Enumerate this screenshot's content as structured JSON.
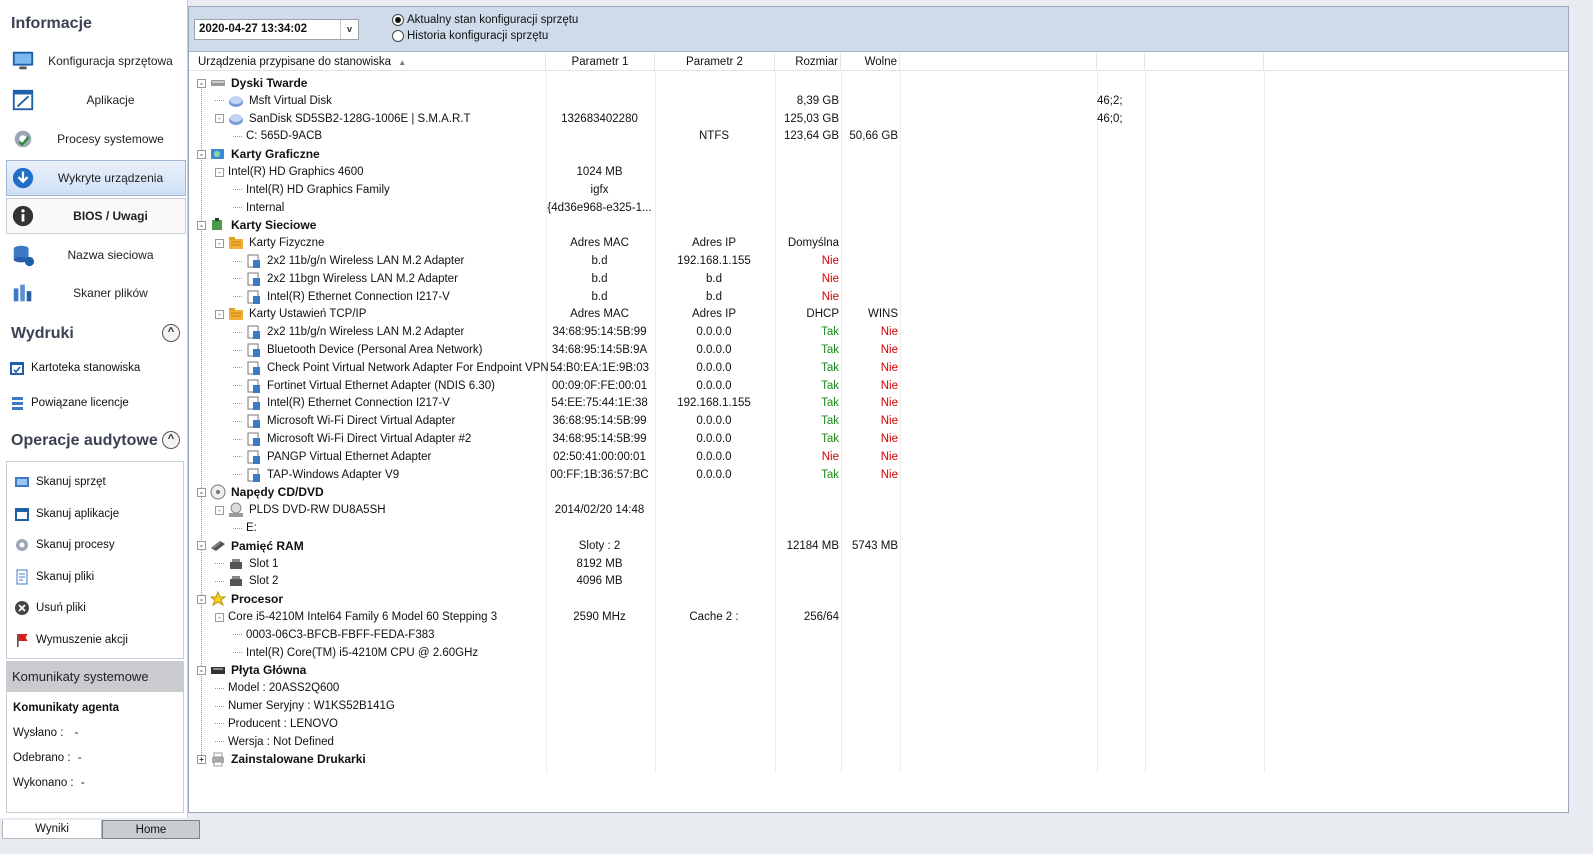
{
  "sidebar": {
    "info_header": "Informacje",
    "nav": [
      {
        "label": "Konfiguracja sprzętowa",
        "icon": "monitor-icon"
      },
      {
        "label": "Aplikacje",
        "icon": "app-window-icon"
      },
      {
        "label": "Procesy systemowe",
        "icon": "gear-process-icon"
      },
      {
        "label": "Wykryte urządzenia",
        "icon": "download-arrow-icon"
      },
      {
        "label": "BIOS / Uwagi",
        "icon": "info-circle-icon"
      },
      {
        "label": "Nazwa sieciowa",
        "icon": "database-network-icon"
      },
      {
        "label": "Skaner plików",
        "icon": "file-scanner-icon"
      }
    ],
    "prints_header": "Wydruki",
    "prints": [
      {
        "label": "Kartoteka stanowiska",
        "icon": "card-file-icon"
      },
      {
        "label": "Powiązane licencje",
        "icon": "license-stack-icon"
      }
    ],
    "ops_header": "Operacje audytowe",
    "ops": [
      {
        "label": "Skanuj sprzęt",
        "icon": "scan-hardware-icon"
      },
      {
        "label": "Skanuj aplikacje",
        "icon": "scan-apps-icon"
      },
      {
        "label": "Skanuj procesy",
        "icon": "scan-process-icon"
      },
      {
        "label": "Skanuj pliki",
        "icon": "scan-files-icon"
      },
      {
        "label": "Usuń pliki",
        "icon": "delete-circle-icon"
      },
      {
        "label": "Wymuszenie akcji",
        "icon": "red-flag-icon"
      }
    ],
    "collapse_glyph": "^",
    "messages": {
      "header": "Komunikaty systemowe",
      "agent_title": "Komunikaty agenta",
      "sent_label": "Wysłano :",
      "sent_value": "-",
      "received_label": "Odebrano :",
      "received_value": "-",
      "done_label": "Wykonano :",
      "done_value": "-"
    }
  },
  "toolbar": {
    "datetime": "2020-04-27   13:34:02",
    "dropdown_glyph": "v",
    "radio_current": "Aktualny stan konfiguracji sprzętu",
    "radio_history": "Historia konfiguracji sprzętu",
    "selected": "current"
  },
  "grid": {
    "columns": [
      "Urządzenia przypisane do stanowiska",
      "Parametr 1",
      "Parametr 2",
      "Rozmiar",
      "Wolne"
    ],
    "sort_glyph": "▲",
    "rows": [
      {
        "level": 0,
        "toggle": "-",
        "icon": "hdd-icon",
        "label": "Dyski Twarde",
        "bold": true
      },
      {
        "level": 1,
        "toggle": "",
        "icon": "disk-icon",
        "label": "Msft Virtual Disk",
        "c3": "8,39 GB",
        "c5": "46;2;"
      },
      {
        "level": 1,
        "toggle": "-",
        "icon": "disk-icon",
        "label": "SanDisk SD5SB2-128G-1006E   |  S.M.A.R.T",
        "c1": "132683402280",
        "c3": "125,03 GB",
        "c5": "46;0;"
      },
      {
        "level": 2,
        "toggle": "",
        "icon": "",
        "label": "C: 565D-9ACB",
        "c2": "NTFS",
        "c3": "123,64 GB",
        "c4": "50,66 GB"
      },
      {
        "level": 0,
        "toggle": "-",
        "icon": "gpu-icon",
        "label": "Karty Graficzne",
        "bold": true
      },
      {
        "level": 1,
        "toggle": "-",
        "icon": "",
        "label": "Intel(R) HD Graphics 4600",
        "c1": "1024 MB"
      },
      {
        "level": 2,
        "toggle": "",
        "icon": "",
        "label": "Intel(R) HD Graphics Family",
        "c1": "igfx"
      },
      {
        "level": 2,
        "toggle": "",
        "icon": "",
        "label": "Internal",
        "c1": "{4d36e968-e325-1..."
      },
      {
        "level": 0,
        "toggle": "-",
        "icon": "network-card-icon",
        "label": "Karty Sieciowe",
        "bold": true
      },
      {
        "level": 1,
        "toggle": "-",
        "icon": "folder-icon",
        "label": "Karty Fizyczne",
        "c1": "Adres MAC",
        "c2": "Adres IP",
        "c3": "Domyślna"
      },
      {
        "level": 2,
        "toggle": "",
        "icon": "adapter-icon",
        "label": "2x2 11b/g/n Wireless LAN M.2 Adapter",
        "c1": "b.d",
        "c2": "192.168.1.155",
        "c3": "Nie",
        "c3c": "red"
      },
      {
        "level": 2,
        "toggle": "",
        "icon": "adapter-icon",
        "label": "2x2 11bgn Wireless LAN M.2 Adapter",
        "c1": "b.d",
        "c2": "b.d",
        "c3": "Nie",
        "c3c": "red"
      },
      {
        "level": 2,
        "toggle": "",
        "icon": "adapter-icon",
        "label": "Intel(R) Ethernet Connection I217-V",
        "c1": "b.d",
        "c2": "b.d",
        "c3": "Nie",
        "c3c": "red"
      },
      {
        "level": 1,
        "toggle": "-",
        "icon": "folder-icon",
        "label": "Karty Ustawień TCP/IP",
        "c1": "Adres MAC",
        "c2": "Adres IP",
        "c3": "DHCP",
        "c4": "WINS"
      },
      {
        "level": 2,
        "toggle": "",
        "icon": "adapter-icon",
        "label": "2x2 11b/g/n Wireless LAN M.2 Adapter",
        "c1": "34:68:95:14:5B:99",
        "c2": "0.0.0.0",
        "c3": "Tak",
        "c3c": "green",
        "c4": "Nie",
        "c4c": "red"
      },
      {
        "level": 2,
        "toggle": "",
        "icon": "adapter-icon",
        "label": "Bluetooth Device (Personal Area Network)",
        "c1": "34:68:95:14:5B:9A",
        "c2": "0.0.0.0",
        "c3": "Tak",
        "c3c": "green",
        "c4": "Nie",
        "c4c": "red"
      },
      {
        "level": 2,
        "toggle": "",
        "icon": "adapter-icon",
        "label": "Check Point Virtual Network Adapter For Endpoint VPN ...",
        "c1": "54:B0:EA:1E:9B:03",
        "c2": "0.0.0.0",
        "c3": "Tak",
        "c3c": "green",
        "c4": "Nie",
        "c4c": "red"
      },
      {
        "level": 2,
        "toggle": "",
        "icon": "adapter-icon",
        "label": "Fortinet Virtual Ethernet Adapter (NDIS 6.30)",
        "c1": "00:09:0F:FE:00:01",
        "c2": "0.0.0.0",
        "c3": "Tak",
        "c3c": "green",
        "c4": "Nie",
        "c4c": "red"
      },
      {
        "level": 2,
        "toggle": "",
        "icon": "adapter-icon",
        "label": "Intel(R) Ethernet Connection I217-V",
        "c1": "54:EE:75:44:1E:38",
        "c2": "192.168.1.155",
        "c3": "Tak",
        "c3c": "green",
        "c4": "Nie",
        "c4c": "red"
      },
      {
        "level": 2,
        "toggle": "",
        "icon": "adapter-icon",
        "label": "Microsoft Wi-Fi Direct Virtual Adapter",
        "c1": "36:68:95:14:5B:99",
        "c2": "0.0.0.0",
        "c3": "Tak",
        "c3c": "green",
        "c4": "Nie",
        "c4c": "red"
      },
      {
        "level": 2,
        "toggle": "",
        "icon": "adapter-icon",
        "label": "Microsoft Wi-Fi Direct Virtual Adapter #2",
        "c1": "34:68:95:14:5B:99",
        "c2": "0.0.0.0",
        "c3": "Tak",
        "c3c": "green",
        "c4": "Nie",
        "c4c": "red"
      },
      {
        "level": 2,
        "toggle": "",
        "icon": "adapter-icon",
        "label": "PANGP Virtual Ethernet Adapter",
        "c1": "02:50:41:00:00:01",
        "c2": "0.0.0.0",
        "c3": "Nie",
        "c3c": "red",
        "c4": "Nie",
        "c4c": "red"
      },
      {
        "level": 2,
        "toggle": "",
        "icon": "adapter-icon",
        "label": "TAP-Windows Adapter V9",
        "c1": "00:FF:1B:36:57:BC",
        "c2": "0.0.0.0",
        "c3": "Tak",
        "c3c": "green",
        "c4": "Nie",
        "c4c": "red"
      },
      {
        "level": 0,
        "toggle": "-",
        "icon": "cd-icon",
        "label": "Napędy CD/DVD",
        "bold": true
      },
      {
        "level": 1,
        "toggle": "-",
        "icon": "dvd-drive-icon",
        "label": "PLDS DVD-RW DU8A5SH",
        "c1": "2014/02/20 14:48"
      },
      {
        "level": 2,
        "toggle": "",
        "icon": "",
        "label": "E:"
      },
      {
        "level": 0,
        "toggle": "-",
        "icon": "ram-icon",
        "label": "Pamięć RAM",
        "bold": true,
        "c1": "Sloty : 2",
        "c3": "12184 MB",
        "c4": "5743 MB"
      },
      {
        "level": 1,
        "toggle": "",
        "icon": "ram-slot-icon",
        "label": "Slot 1",
        "c1": "8192 MB"
      },
      {
        "level": 1,
        "toggle": "",
        "icon": "ram-slot-icon",
        "label": "Slot 2",
        "c1": "4096 MB"
      },
      {
        "level": 0,
        "toggle": "-",
        "icon": "star-cpu-icon",
        "label": "Procesor",
        "bold": true
      },
      {
        "level": 1,
        "toggle": "-",
        "icon": "",
        "label": "Core i5-4210M Intel64 Family 6 Model 60 Stepping 3",
        "c1": "2590 MHz",
        "c2": "Cache 2 :",
        "c3": "256/64"
      },
      {
        "level": 2,
        "toggle": "",
        "icon": "",
        "label": "0003-06C3-BFCB-FBFF-FEDA-F383"
      },
      {
        "level": 2,
        "toggle": "",
        "icon": "",
        "label": "Intel(R) Core(TM) i5-4210M CPU @ 2.60GHz"
      },
      {
        "level": 0,
        "toggle": "-",
        "icon": "motherboard-icon",
        "label": "Płyta Główna",
        "bold": true
      },
      {
        "level": 1,
        "toggle": "",
        "icon": "",
        "label": "Model : 20ASS2Q600"
      },
      {
        "level": 1,
        "toggle": "",
        "icon": "",
        "label": "Numer Seryjny : W1KS52B141G"
      },
      {
        "level": 1,
        "toggle": "",
        "icon": "",
        "label": "Producent : LENOVO"
      },
      {
        "level": 1,
        "toggle": "",
        "icon": "",
        "label": "Wersja : Not Defined"
      },
      {
        "level": 0,
        "toggle": "+",
        "icon": "printer-icon",
        "label": "Zainstalowane Drukarki",
        "bold": true
      }
    ]
  },
  "tabs": [
    "Wyniki",
    "Home"
  ],
  "colors": {
    "accent": "#cfdbea",
    "red": "#d00000",
    "green": "#1a8a1a"
  }
}
